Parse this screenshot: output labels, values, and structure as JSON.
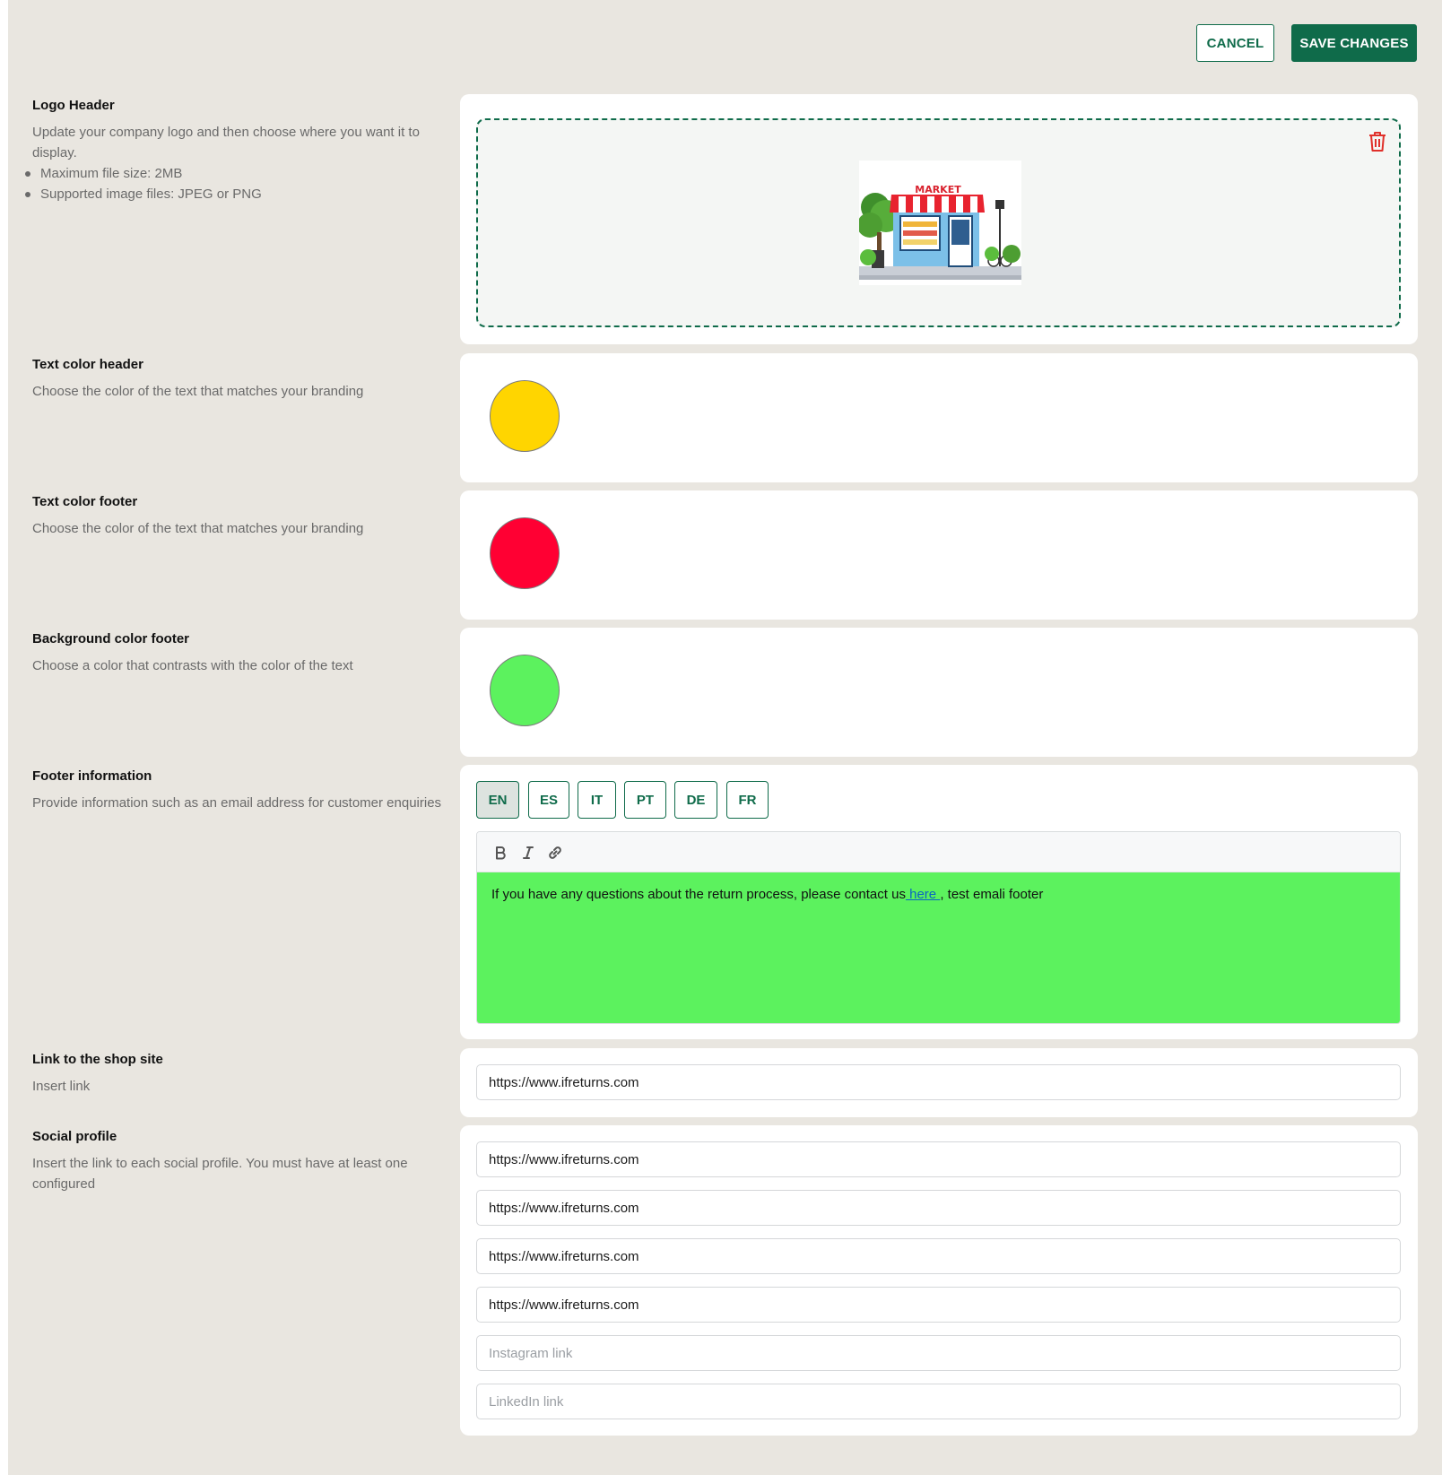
{
  "actions": {
    "cancel_label": "CANCEL",
    "save_label": "SAVE CHANGES"
  },
  "logo_header": {
    "title": "Logo Header",
    "description": "Update your company logo and then choose where you want it to display.",
    "bullets": [
      "Maximum file size: 2MB",
      "Supported image files: JPEG or PNG"
    ],
    "image_sign_text": "MARKET",
    "delete_icon": "trash-icon"
  },
  "text_color_header": {
    "title": "Text color header",
    "description": "Choose the color of the text that matches your branding",
    "color": "#ffd500"
  },
  "text_color_footer": {
    "title": "Text color footer",
    "description": "Choose the color of the text that matches your branding",
    "color": "#ff0033"
  },
  "background_color_footer": {
    "title": "Background color footer",
    "description": "Choose a color that contrasts with the color of the text",
    "color": "#5cf25e"
  },
  "footer_information": {
    "title": "Footer information",
    "description": "Provide information such as an email address for customer enquiries",
    "languages": [
      "EN",
      "ES",
      "IT",
      "PT",
      "DE",
      "FR"
    ],
    "active_language": "EN",
    "toolbar": [
      "bold-icon",
      "italic-icon",
      "link-icon"
    ],
    "content_before_link": "If you have any questions about the return process, please contact us",
    "link_text": " here ",
    "content_after_link": ", test emali footer"
  },
  "shop_link": {
    "title": "Link to the shop site",
    "description": "Insert link",
    "value": "https://www.ifreturns.com"
  },
  "social_profile": {
    "title": "Social profile",
    "description": "Insert the link to each social profile. You must have at least one configured",
    "links": [
      {
        "value": "https://www.ifreturns.com",
        "placeholder": ""
      },
      {
        "value": "https://www.ifreturns.com",
        "placeholder": ""
      },
      {
        "value": "https://www.ifreturns.com",
        "placeholder": ""
      },
      {
        "value": "https://www.ifreturns.com",
        "placeholder": ""
      },
      {
        "value": "",
        "placeholder": "Instagram link"
      },
      {
        "value": "",
        "placeholder": "LinkedIn link"
      }
    ]
  }
}
